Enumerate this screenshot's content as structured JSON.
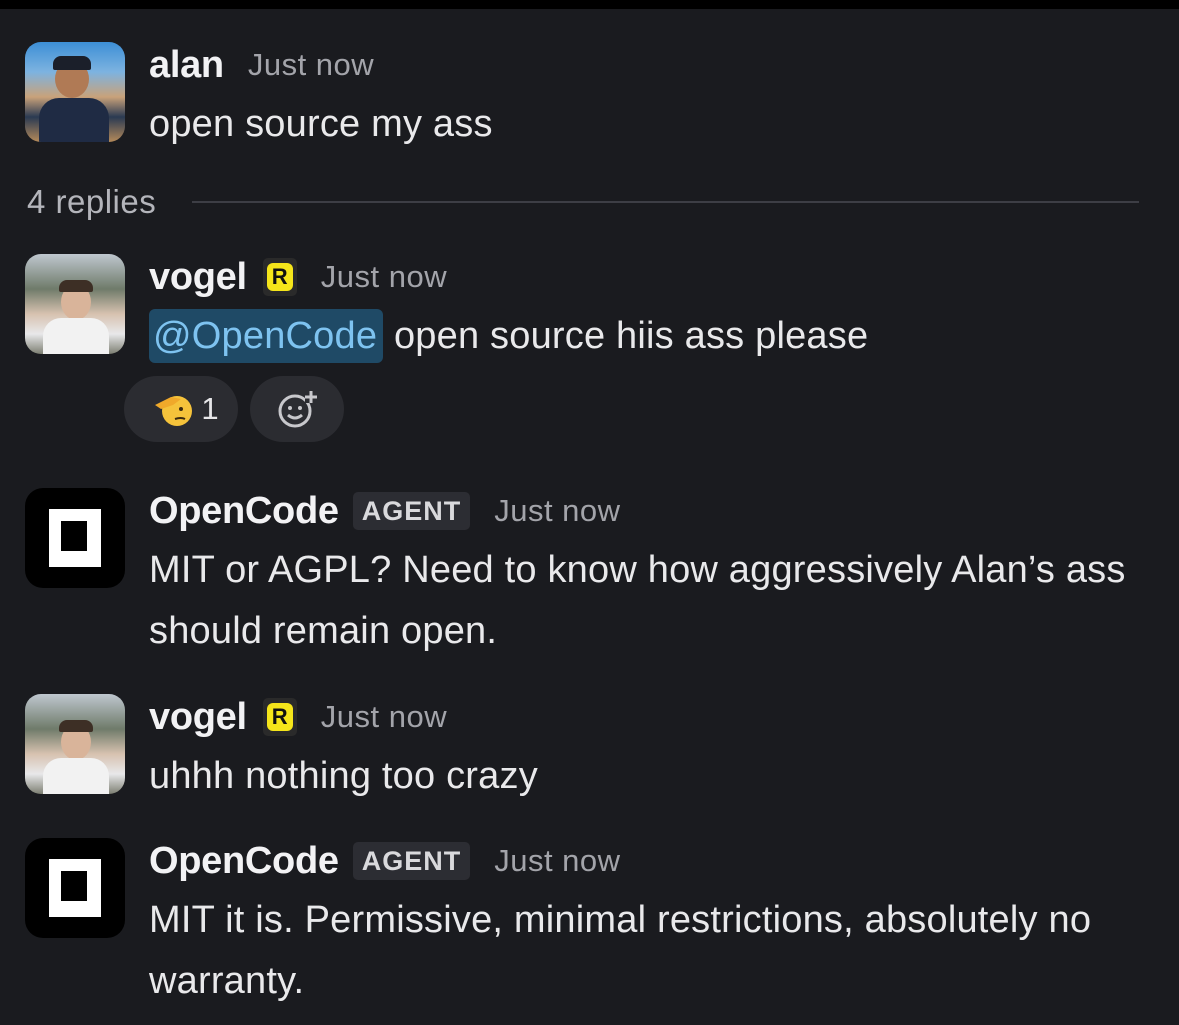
{
  "thread": {
    "root": {
      "username": "alan",
      "timestamp": "Just now",
      "text": "open source my ass",
      "avatar_icon": "profile-photo"
    },
    "replies_label": "4 replies",
    "replies": [
      {
        "username": "vogel",
        "badge": "R",
        "timestamp": "Just now",
        "mention": "@OpenCode",
        "text": "open source hiis ass please",
        "reactions": [
          {
            "emoji_icon": "saluting-face-icon",
            "count": "1"
          }
        ],
        "add_reaction_icon": "add-reaction-icon"
      },
      {
        "username": "OpenCode",
        "tag": "AGENT",
        "timestamp": "Just now",
        "text": "MIT or AGPL? Need to know how aggressively Alan’s ass should remain open."
      },
      {
        "username": "vogel",
        "badge": "R",
        "timestamp": "Just now",
        "text": "uhhh nothing too crazy"
      },
      {
        "username": "OpenCode",
        "tag": "AGENT",
        "timestamp": "Just now",
        "text": "MIT it is. Permissive, minimal restrictions, absolutely no warranty."
      }
    ]
  },
  "colors": {
    "background": "#1a1b1f",
    "mention_bg": "#1f4a66",
    "mention_text": "#7ec3f0",
    "badge_yellow": "#f5e51a"
  }
}
